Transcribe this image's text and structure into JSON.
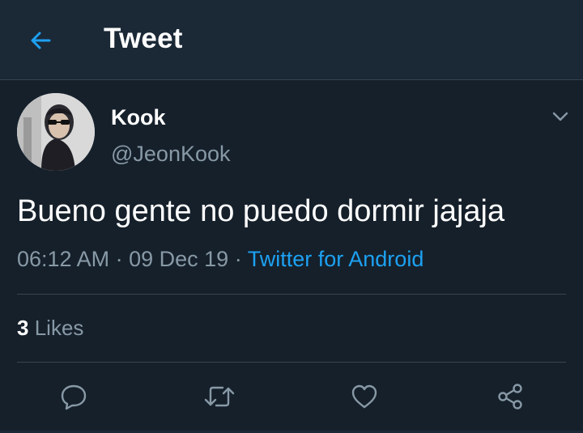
{
  "header": {
    "title": "Tweet",
    "back_icon": "arrow-left-icon",
    "accent": "#1da1f2"
  },
  "tweet": {
    "author": {
      "display_name": "Kook",
      "handle": "@JeonKook",
      "avatar_icon": "profile-photo"
    },
    "text": "Bueno gente no puedo dormir jajaja",
    "time": "06:12 AM",
    "date": "09 Dec 19",
    "separator": "·",
    "source": "Twitter for Android",
    "likes": {
      "count": "3",
      "label": "Likes"
    },
    "actions": [
      {
        "icon": "reply-icon"
      },
      {
        "icon": "retweet-icon"
      },
      {
        "icon": "like-icon"
      },
      {
        "icon": "share-icon"
      }
    ]
  },
  "colors": {
    "background": "#15202b",
    "header_bg": "#1b2836",
    "secondary_text": "#8899a6",
    "divider": "#38444d"
  }
}
